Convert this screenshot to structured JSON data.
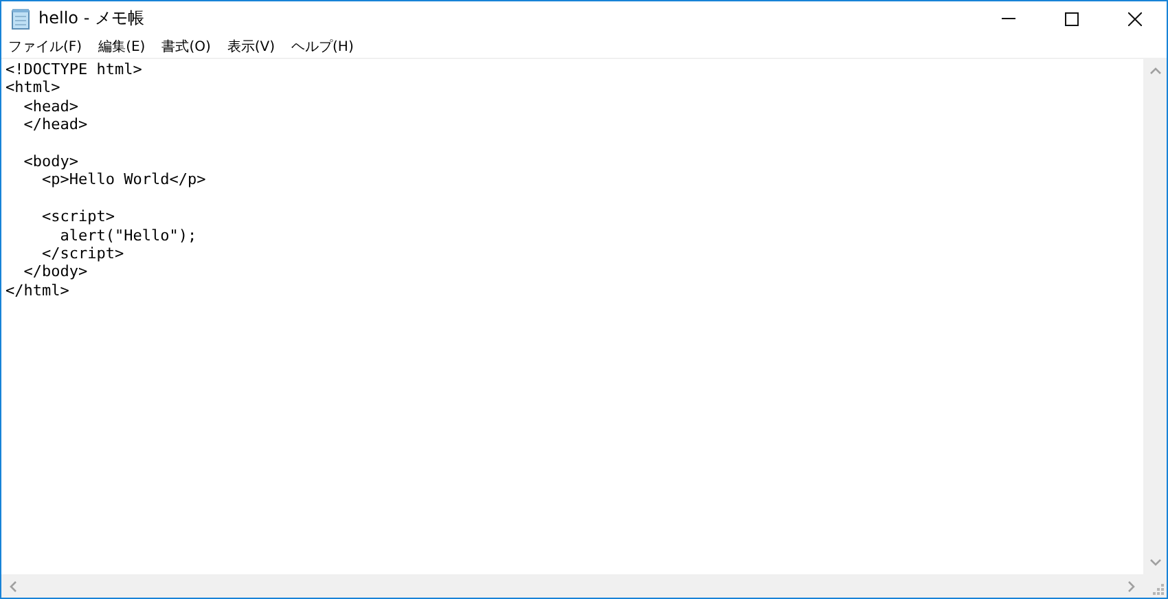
{
  "window": {
    "title": "hello - メモ帳"
  },
  "menu": [
    {
      "label": "ファイル(F)"
    },
    {
      "label": "編集(E)"
    },
    {
      "label": "書式(O)"
    },
    {
      "label": "表示(V)"
    },
    {
      "label": "ヘルプ(H)"
    }
  ],
  "editor": {
    "text": "<!DOCTYPE html>\n<html>\n  <head>\n  </head>\n\n  <body>\n    <p>Hello World</p>\n\n    <script>\n      alert(\"Hello\");\n    </script>\n  </body>\n</html>"
  }
}
